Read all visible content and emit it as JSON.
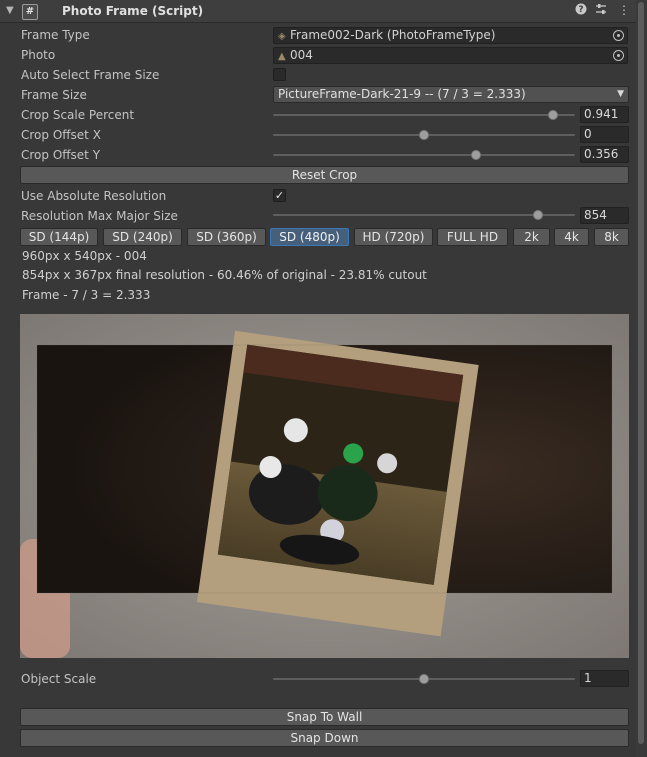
{
  "header": {
    "title": "Photo Frame (Script)",
    "script_icon": "#",
    "help_icon": "?",
    "settings_icon": "⚙",
    "menu_icon": "⋮",
    "fold_icon": "▼"
  },
  "fields": {
    "frame_type": {
      "label": "Frame Type",
      "value": "Frame002-Dark (PhotoFrameType)"
    },
    "photo": {
      "label": "Photo",
      "value": "004"
    },
    "auto_select": {
      "label": "Auto Select Frame Size",
      "checked": false
    },
    "frame_size": {
      "label": "Frame Size",
      "value": "PictureFrame-Dark-21-9 -- (7 / 3 = 2.333)"
    },
    "crop_scale": {
      "label": "Crop Scale Percent",
      "value": "0.941",
      "level": 0.941
    },
    "crop_offset_x": {
      "label": "Crop Offset X",
      "value": "0",
      "level": 0.5
    },
    "crop_offset_y": {
      "label": "Crop Offset Y",
      "value": "0.356",
      "level": 0.678
    },
    "reset_crop": "Reset Crop",
    "use_absolute": {
      "label": "Use Absolute Resolution",
      "checked": true
    },
    "res_max": {
      "label": "Resolution Max Major Size",
      "value": "854",
      "level": 0.88
    },
    "object_scale": {
      "label": "Object Scale",
      "value": "1",
      "level": 0.5
    }
  },
  "resolution_buttons": [
    {
      "label": "SD (144p)",
      "active": false
    },
    {
      "label": "SD (240p)",
      "active": false
    },
    {
      "label": "SD (360p)",
      "active": false
    },
    {
      "label": "SD (480p)",
      "active": true
    },
    {
      "label": "HD (720p)",
      "active": false
    },
    {
      "label": "FULL HD",
      "active": false
    },
    {
      "label": "2k",
      "active": false
    },
    {
      "label": "4k",
      "active": false
    },
    {
      "label": "8k",
      "active": false
    }
  ],
  "info": {
    "line1": "960px x 540px - 004",
    "line2": "854px x 367px final resolution - 60.46% of original - 23.81% cutout",
    "line3": "Frame - 7 / 3 = 2.333"
  },
  "actions": {
    "snap_to_wall": "Snap To Wall",
    "snap_down": "Snap Down"
  },
  "colors": {
    "panel_bg": "#383838",
    "active_button": "#46607c",
    "preview_bg": "#8e8a86"
  }
}
